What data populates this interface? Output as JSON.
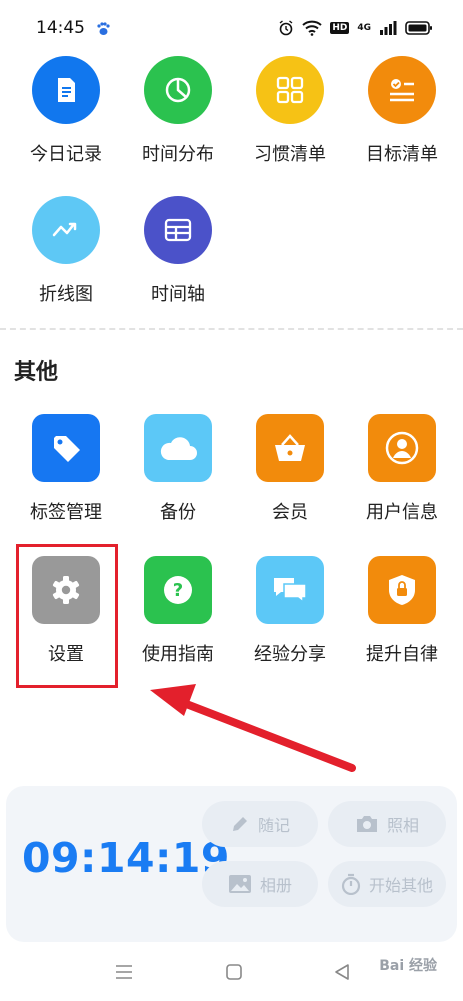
{
  "status_bar": {
    "time": "14:45",
    "hd": "HD",
    "network": "4G"
  },
  "top_items": [
    {
      "label": "今日记录",
      "color": "#1177ee"
    },
    {
      "label": "时间分布",
      "color": "#2bc24f"
    },
    {
      "label": "习惯清单",
      "color": "#f6c215"
    },
    {
      "label": "目标清单",
      "color": "#f28b0c"
    },
    {
      "label": "折线图",
      "color": "#5ec8f5"
    },
    {
      "label": "时间轴",
      "color": "#4b52c9"
    }
  ],
  "section_title": "其他",
  "other_items": [
    {
      "label": "标签管理",
      "color": "#1677f2"
    },
    {
      "label": "备份",
      "color": "#5cc8f7"
    },
    {
      "label": "会员",
      "color": "#f28b0c"
    },
    {
      "label": "用户信息",
      "color": "#f28b0c"
    },
    {
      "label": "设置",
      "color": "#999999"
    },
    {
      "label": "使用指南",
      "color": "#2bc24f"
    },
    {
      "label": "经验分享",
      "color": "#5cc8f7"
    },
    {
      "label": "提升自律",
      "color": "#f28b0c"
    }
  ],
  "timer": {
    "value": "09:14:19",
    "color": "#1a7cf3"
  },
  "actions": [
    {
      "label": "随记",
      "icon": "pencil-icon"
    },
    {
      "label": "照相",
      "icon": "camera-icon"
    },
    {
      "label": "相册",
      "icon": "image-icon"
    },
    {
      "label": "开始其他",
      "icon": "stopwatch-icon"
    }
  ],
  "watermark": "Bai 经验"
}
